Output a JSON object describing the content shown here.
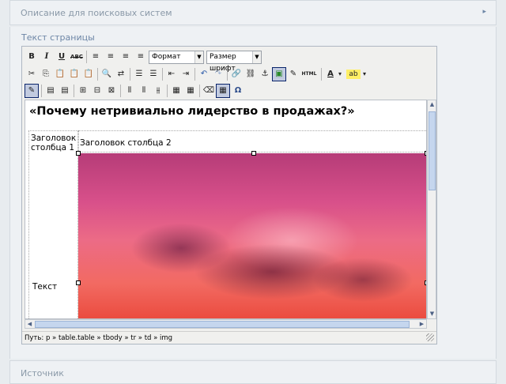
{
  "top_section": {
    "label": "Описание для поисковых систем",
    "chevron": "▸"
  },
  "main_section": {
    "label": "Текст страницы"
  },
  "bottom_section": {
    "label": "Источник"
  },
  "toolbar1": {
    "bold": "B",
    "italic": "I",
    "underline": "U",
    "strike": "ABC",
    "align_left": "≡",
    "align_center": "≡",
    "align_right": "≡",
    "align_justify": "≡",
    "format_select": "Формат",
    "size_select": "Размер шрифт",
    "select_arrow": "▼"
  },
  "toolbar2": {
    "cut": "✂",
    "copy": "⎘",
    "paste": "📋",
    "paste_text": "📋",
    "paste_word": "📋",
    "find": "🔍",
    "replace": "⇄",
    "bullet_list": "☰",
    "numbered_list": "☰",
    "outdent": "⇤",
    "indent": "⇥",
    "undo": "↶",
    "redo": "↷",
    "link": "🔗",
    "unlink": "⛓",
    "anchor": "⚓",
    "image": "▣",
    "cleanup": "✎",
    "html": "HTML",
    "text_color": "A",
    "bg_color": "ab",
    "dropdown": "▾"
  },
  "toolbar3": {
    "toggle_guides": "✎",
    "insert_row_before": "▤",
    "insert_row_after": "▤",
    "row_props": "⊞",
    "cell_props": "⊟",
    "delete_row": "⊠",
    "insert_col_before": "⫴",
    "insert_col_after": "⫴",
    "delete_col": "⫵",
    "split_cells": "▦",
    "merge_cells": "▦",
    "erase": "⌫",
    "table": "▦",
    "special_char": "Ω"
  },
  "document": {
    "title": "«Почему нетривиально лидерство в продажах?»",
    "col_header_1": "Заголовок столбца 1",
    "col_header_2": "Заголовок столбца 2",
    "cell_text": "Текст"
  },
  "statusbar": {
    "path": "Путь: p » table.table » tbody » tr » td » img"
  },
  "scroll": {
    "up": "▲",
    "down": "▼",
    "left": "◀",
    "right": "▶",
    "grip": "⋯"
  }
}
